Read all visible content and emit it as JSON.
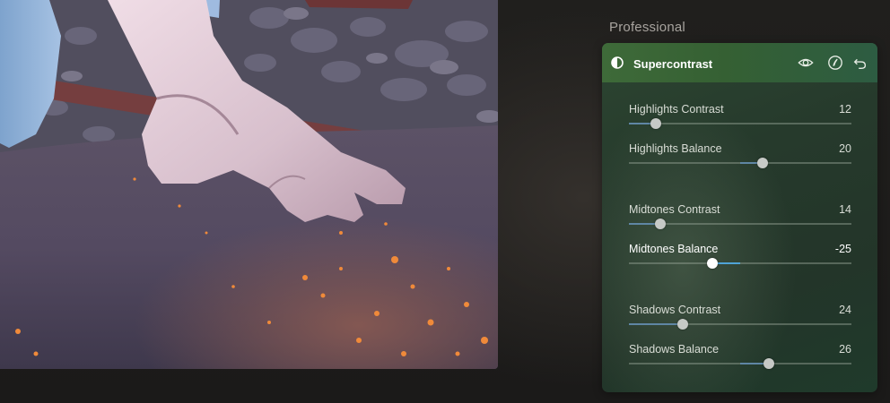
{
  "panel": {
    "section_title": "Professional",
    "filter": {
      "title": "Supercontrast",
      "icon": "half-circle-contrast-icon",
      "header_buttons": [
        {
          "name": "visibility-toggle-button",
          "icon": "eye-icon"
        },
        {
          "name": "mask-button",
          "icon": "brush-mask-icon"
        },
        {
          "name": "reset-button",
          "icon": "undo-arrow-icon"
        }
      ],
      "header_color": "#3e6a39",
      "sliders": [
        {
          "label": "Highlights Contrast",
          "value": "12",
          "min": 0,
          "max": 100,
          "num": 12,
          "bipolar": false,
          "active": false
        },
        {
          "label": "Highlights Balance",
          "value": "20",
          "min": -100,
          "max": 100,
          "num": 20,
          "bipolar": true,
          "active": false
        },
        {
          "label": "Midtones Contrast",
          "value": "14",
          "min": 0,
          "max": 100,
          "num": 14,
          "bipolar": false,
          "active": false
        },
        {
          "label": "Midtones Balance",
          "value": "-25",
          "min": -100,
          "max": 100,
          "num": -25,
          "bipolar": true,
          "active": true
        },
        {
          "label": "Shadows Contrast",
          "value": "24",
          "min": 0,
          "max": 100,
          "num": 24,
          "bipolar": false,
          "active": false
        },
        {
          "label": "Shadows Balance",
          "value": "26",
          "min": -100,
          "max": 100,
          "num": 26,
          "bipolar": true,
          "active": false
        }
      ]
    }
  },
  "canvas": {
    "image": "photo-of-gloved-hand-on-rusty-pipe"
  },
  "colors": {
    "accent_fill": "#5f86a4",
    "active_fill": "#4fa3d6",
    "panel_bg": "#263a2c"
  }
}
